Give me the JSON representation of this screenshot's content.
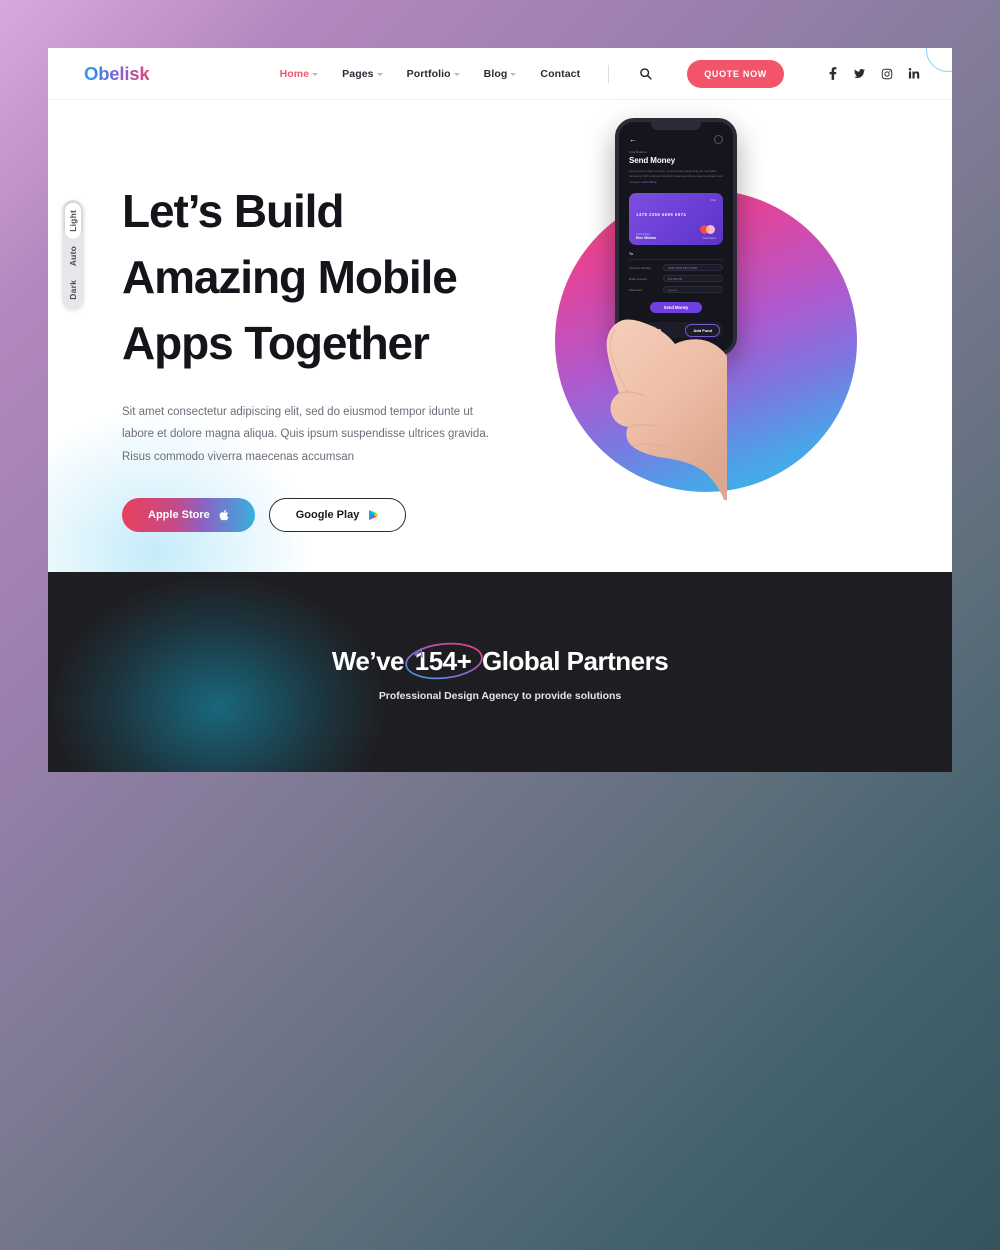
{
  "header": {
    "logo": "Obelisk",
    "nav": [
      {
        "label": "Home",
        "caret": true,
        "active": true
      },
      {
        "label": "Pages",
        "caret": true,
        "active": false
      },
      {
        "label": "Portfolio",
        "caret": true,
        "active": false
      },
      {
        "label": "Blog",
        "caret": true,
        "active": false
      },
      {
        "label": "Contact",
        "caret": false,
        "active": false
      }
    ],
    "search_icon": "search-icon",
    "quote_label": "QUOTE NOW",
    "socials": [
      "facebook-icon",
      "twitter-icon",
      "instagram-icon",
      "linkedin-icon"
    ],
    "accent_color": "#f2556b"
  },
  "theme_switcher": {
    "options": [
      "Light",
      "Auto",
      "Dark"
    ],
    "selected": "Light"
  },
  "hero": {
    "title_line1": "Let’s Build",
    "title_line2": "Amazing Mobile",
    "title_line3": "Apps Together",
    "paragraph": "Sit amet consectetur adipiscing elit, sed do eiusmod tempor idunte ut labore et dolore magna aliqua. Quis ipsum suspendisse ultrices gravida. Risus commodo viverra maecenas accumsan",
    "apple_button": "Apple Store",
    "apple_icon": "apple-logo-icon",
    "google_button": "Google Play",
    "google_icon": "google-play-icon"
  },
  "phone": {
    "eyebrow": "Total Balance",
    "title": "Send Money",
    "description": "Lorem ipsum dolor sit amet, consectetuer adipiscing elit, sed diam nonummy nibh euismod tincidunt ut laoreet dolore magna aliquam erat volutpat.",
    "description_link": "Learn More",
    "card": {
      "brand": "Visa",
      "number": "1478 2356 6595 5874",
      "holder_label": "Card Holder",
      "holder_name": "Elor Winton",
      "type": "Card Name",
      "logo": "mastercard-icon"
    },
    "to_label": "To",
    "fields": [
      {
        "label": "Account Number",
        "value": "2255 4595 5874 4455"
      },
      {
        "label": "Enter Amount",
        "value": "$ 2,156.00"
      },
      {
        "label": "Password",
        "value": "•••••••••"
      }
    ],
    "send_button": "Send Money",
    "balance_label": "Available Balance",
    "balance_value": "$ 1,701.59",
    "add_fund_button": "Add Fund"
  },
  "partners": {
    "title_before": "We’ve",
    "title_highlight": "154+",
    "title_after": "Global Partners",
    "subtitle": "Professional Design Agency to provide solutions"
  }
}
